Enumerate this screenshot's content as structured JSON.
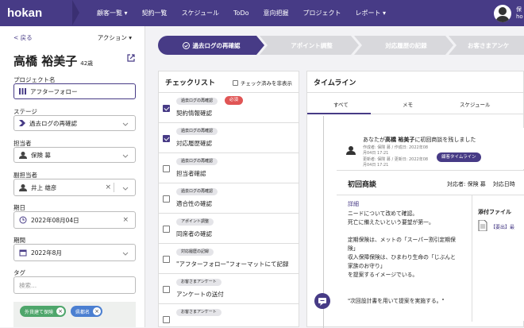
{
  "nav": {
    "logo": "hokan",
    "items": [
      "顧客一覧 ▾",
      "契約一覧",
      "スケジュール",
      "ToDo",
      "意向把握",
      "プロジェクト",
      "レポート ▾"
    ],
    "user_line1": "保",
    "user_line2": "ho"
  },
  "left": {
    "back": "< 戻る",
    "action": "アクション ▾",
    "name": "高橋 裕美子",
    "age": "42歳",
    "fields": {
      "project_label": "プロジェクト名",
      "project_value": "アフターフォロー",
      "stage_label": "ステージ",
      "stage_value": "過去ログの再確認",
      "owner_label": "担当者",
      "owner_value": "保険 募",
      "sub_owner_label": "副担当者",
      "sub_owner_value": "井上 雄彦",
      "date_label": "期日",
      "date_value": "2022年08月04日",
      "period_label": "期間",
      "period_value": "2022年8月",
      "tag_label": "タグ",
      "tag_placeholder": "検索..."
    },
    "tags": [
      {
        "label": "外貨建て保険",
        "color": "#4ea66b"
      },
      {
        "label": "県都名",
        "color": "#4b7fd1"
      }
    ]
  },
  "steps": [
    "過去ログの再確認",
    "アポイント調整",
    "対応履歴の記録",
    "お客さまアンケ"
  ],
  "checklist": {
    "title": "チェックリスト",
    "toggle_label": "チェック済みを非表示",
    "items": [
      {
        "badge": "過去ログの再確認",
        "text": "契約情報確認",
        "checked": true,
        "required": "必須"
      },
      {
        "badge": "過去ログの再確認",
        "text": "対応履歴確認",
        "checked": true
      },
      {
        "badge": "過去ログの再確認",
        "text": "担当者確認",
        "checked": false
      },
      {
        "badge": "過去ログの再確認",
        "text": "適合性の確認",
        "checked": false
      },
      {
        "badge": "アポイント調整",
        "text": "同席者の確認",
        "checked": false
      },
      {
        "badge": "対応履歴の記録",
        "text": "\"アフターフォロー\"フォーマットにて記録",
        "checked": false
      },
      {
        "badge": "お客さまアンケート",
        "text": "アンケートの送付",
        "checked": false
      },
      {
        "badge": "お客さまアンケート",
        "text": "",
        "checked": false
      }
    ]
  },
  "timeline": {
    "title": "タイムライン",
    "tabs": [
      "すべて",
      "メモ",
      "スケジュール"
    ],
    "notification": {
      "text_pre": "あなたが",
      "text_name": "高橋 裕美子",
      "text_post": "に初回商談を残しました",
      "meta1": "作成者: 保険 募 / 作成日: 2022年08",
      "meta2": "月04日 17:21",
      "meta3": "更新者: 保険 募 / 更新日: 2022年08",
      "meta4": "月04日 17:21",
      "badge": "顧客タイムライン"
    },
    "meeting": {
      "title": "初回商談",
      "responder": "対応者: 保険 募",
      "date_label": "対応日時",
      "detail_label": "詳細",
      "body": [
        "ニードについて改めて確認。",
        "死亡に備えたいという要望が第一。",
        "",
        "定期保険は、メットの「スーパー割引定期保",
        "険」",
        "収入保障保険は、ひまわり生命の「じぶんと",
        "家族のお守り」",
        "を提案するイメージでいる。",
        "",
        "\"次回設計書を用いて提案を実施する。\""
      ],
      "attachment_label": "添付ファイル",
      "file": "【要出】最"
    }
  },
  "colors": {
    "brand": "#473b86",
    "required": "#e05555"
  }
}
